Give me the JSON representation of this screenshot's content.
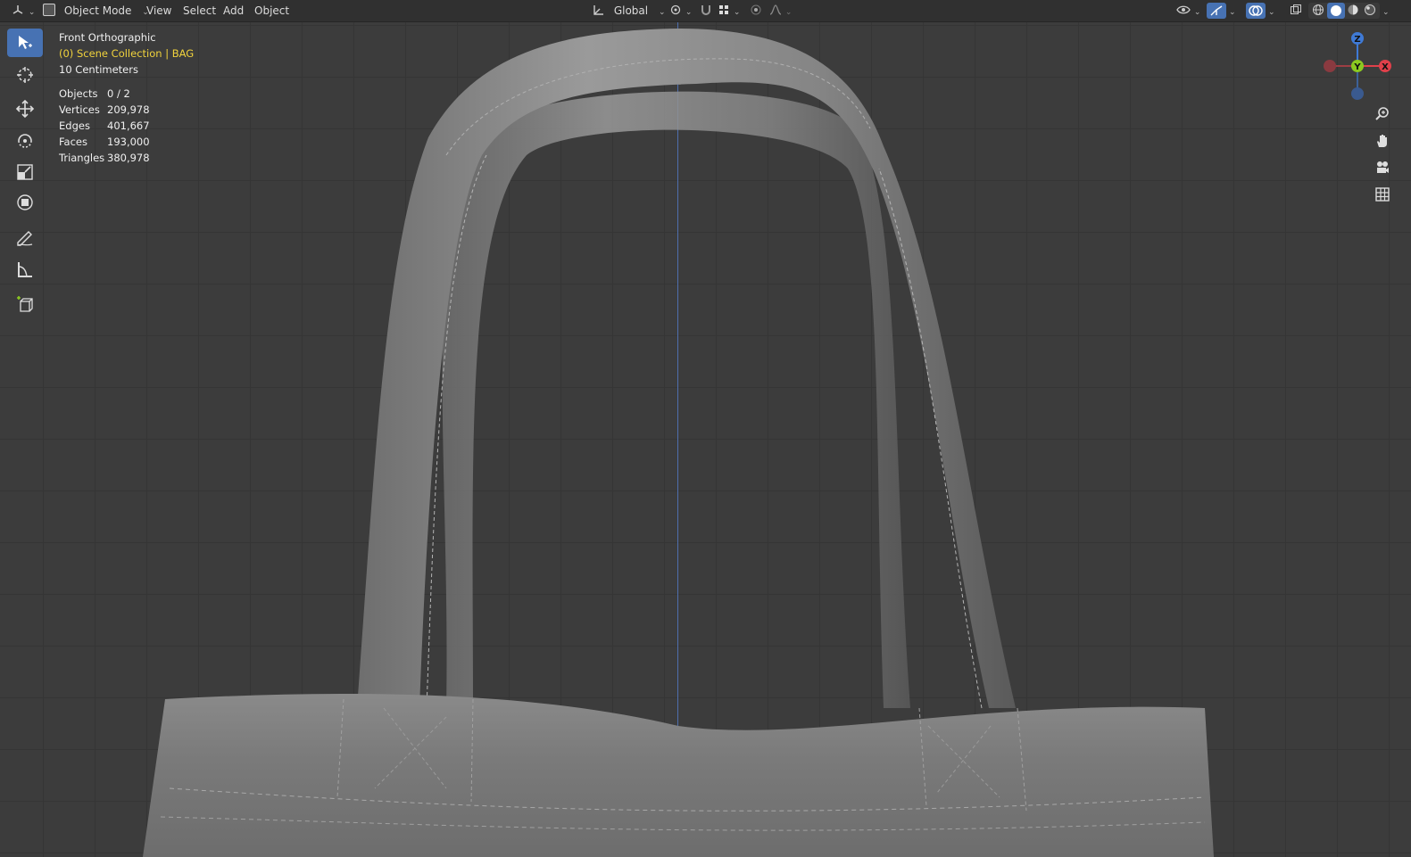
{
  "header": {
    "editor_type_icon": "3d-viewport-editor-icon",
    "mode_label": "Object Mode",
    "menus": [
      "View",
      "Select",
      "Add",
      "Object"
    ],
    "transform_orientation": "Global",
    "icons": {
      "transform_orientation": "transform-orientation-icon",
      "pivot": "pivot-point-icon",
      "snap": "snap-magnet-icon",
      "snap_target": "snap-increment-icon",
      "proportional": "proportional-editing-icon",
      "falloff": "falloff-curve-icon",
      "visibility": "visibility-eye-icon",
      "gizmos": "gizmo-icon",
      "overlays": "overlays-icon",
      "xray": "xray-toggle-icon",
      "shading_wireframe": "wireframe-shading-icon",
      "shading_solid": "solid-shading-icon",
      "shading_material": "material-preview-icon",
      "shading_rendered": "rendered-shading-icon"
    }
  },
  "toolbar": {
    "tools": [
      {
        "name": "select-box-tool",
        "icon": "cursor-select-icon",
        "active": true
      },
      {
        "name": "cursor-tool",
        "icon": "3d-cursor-icon",
        "active": false
      },
      {
        "name": "move-tool",
        "icon": "move-arrows-icon",
        "active": false
      },
      {
        "name": "rotate-tool",
        "icon": "rotate-icon",
        "active": false
      },
      {
        "name": "scale-tool",
        "icon": "scale-icon",
        "active": false
      },
      {
        "name": "transform-tool",
        "icon": "transform-icon",
        "active": false
      },
      {
        "name": "annotate-tool",
        "icon": "annotate-pencil-icon",
        "active": false
      },
      {
        "name": "measure-tool",
        "icon": "measure-ruler-icon",
        "active": false
      },
      {
        "name": "add-cube-tool",
        "icon": "add-cube-icon",
        "active": false
      }
    ]
  },
  "overlay": {
    "view_name": "Front Orthographic",
    "collection": "(0) Scene Collection | BAG",
    "grid_scale": "10 Centimeters"
  },
  "stats": [
    {
      "label": "Objects",
      "value": "0 / 2"
    },
    {
      "label": "Vertices",
      "value": "209,978"
    },
    {
      "label": "Edges",
      "value": "401,667"
    },
    {
      "label": "Faces",
      "value": "193,000"
    },
    {
      "label": "Triangles",
      "value": "380,978"
    }
  ],
  "gizmo": {
    "axes": [
      "Z",
      "Y",
      "X"
    ],
    "colors": {
      "x": "#e0404a",
      "y": "#8bc920",
      "z": "#3f7ad6"
    }
  },
  "nav_buttons": [
    {
      "name": "zoom-button",
      "icon": "zoom-magnifier-icon"
    },
    {
      "name": "pan-button",
      "icon": "pan-hand-icon"
    },
    {
      "name": "camera-view-button",
      "icon": "camera-icon"
    },
    {
      "name": "ortho-toggle-button",
      "icon": "grid-ortho-icon"
    }
  ],
  "colors": {
    "accent": "#4772b3",
    "header_bg": "#303030",
    "viewport_bg": "#3c3c3c",
    "collection_text": "#f0d23c",
    "vertical_axis": "#4f6fae"
  }
}
